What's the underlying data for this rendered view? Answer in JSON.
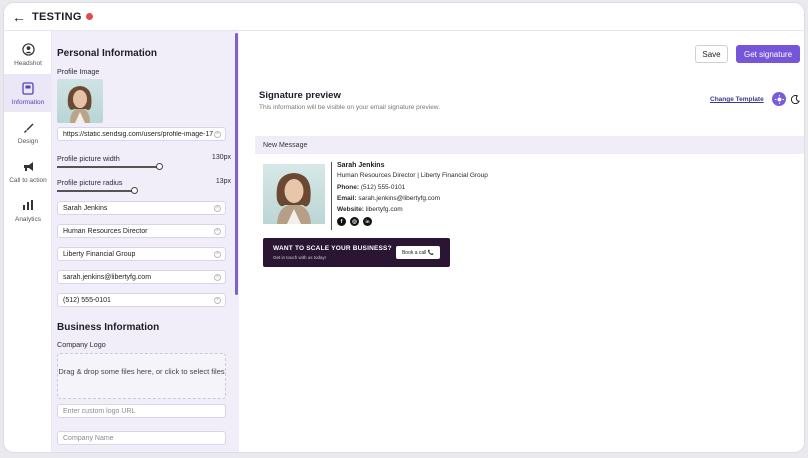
{
  "app": {
    "title": "TESTING"
  },
  "rail": [
    {
      "label": "Headshot",
      "icon": "user-circle-icon"
    },
    {
      "label": "Information",
      "icon": "id-card-icon"
    },
    {
      "label": "Design",
      "icon": "brush-icon"
    },
    {
      "label": "Call to action",
      "icon": "megaphone-icon"
    },
    {
      "label": "Analytics",
      "icon": "bar-chart-icon"
    }
  ],
  "form": {
    "personal_title": "Personal Information",
    "profile_image_label": "Profile Image",
    "image_url": "https://static.sendsig.com/users/profile-image-1733...",
    "picture_width_label": "Profile picture width",
    "picture_width_value": "130px",
    "picture_radius_label": "Profile picture radius",
    "picture_radius_value": "13px",
    "name": "Sarah Jenkins",
    "job_title": "Human Resources Director",
    "company": "Liberty Financial Group",
    "email": "sarah.jenkins@libertyfg.com",
    "phone": "(512) 555-0101",
    "business_title": "Business Information",
    "company_logo_label": "Company Logo",
    "dropzone_text": "Drag & drop some files here, or click to select files",
    "logo_url_placeholder": "Enter custom logo URL",
    "company_name_placeholder": "Company Name"
  },
  "toolbar": {
    "save_label": "Save",
    "get_label": "Get signature"
  },
  "preview": {
    "title": "Signature preview",
    "subtitle": "This information will be visible on your email signature preview.",
    "change_template": "Change Template",
    "new_message": "New Message"
  },
  "signature": {
    "name": "Sarah Jenkins",
    "title_line": "Human Resources Director | Liberty Financial Group",
    "phone_label": "Phone:",
    "phone": "(512) 555-0101",
    "email_label": "Email:",
    "email": "sarah.jenkins@libertyfg.com",
    "website_label": "Website:",
    "website": "libertyfg.com",
    "social": [
      "f",
      "◎",
      "in"
    ],
    "cta_heading": "WANT TO SCALE YOUR BUSINESS?",
    "cta_sub": "Get in touch with us today!",
    "cta_button": "Book a call 📞"
  },
  "colors": {
    "accent": "#7755d9",
    "form_bg": "#f1eefa",
    "cta_bg": "#2a1633"
  }
}
